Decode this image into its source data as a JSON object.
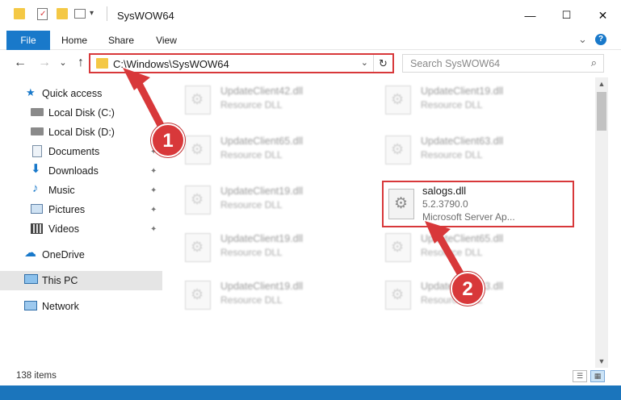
{
  "window": {
    "title": "SysWOW64",
    "minimize_symbol": "—",
    "maximize_symbol": "☐",
    "close_symbol": "✕"
  },
  "ribbon": {
    "tabs": [
      "File",
      "Home",
      "Share",
      "View"
    ],
    "expand_symbol": "⌄",
    "help_symbol": "?"
  },
  "navigation": {
    "back_symbol": "←",
    "forward_symbol": "→",
    "recent_symbol": "⌄",
    "up_symbol": "↑"
  },
  "address": {
    "path": "C:\\Windows\\SysWOW64",
    "dropdown_symbol": "⌄",
    "refresh_symbol": "↻"
  },
  "search": {
    "placeholder": "Search SysWOW64",
    "icon_symbol": "⌕"
  },
  "sidebar": {
    "items": [
      {
        "label": "Quick access",
        "icon": "star-icon"
      },
      {
        "label": "Local Disk (C:)",
        "icon": "drive-icon"
      },
      {
        "label": "Local Disk (D:)",
        "icon": "drive-icon"
      },
      {
        "label": "Documents",
        "icon": "documents-icon"
      },
      {
        "label": "Downloads",
        "icon": "download-icon"
      },
      {
        "label": "Music",
        "icon": "music-icon"
      },
      {
        "label": "Pictures",
        "icon": "pictures-icon"
      },
      {
        "label": "Videos",
        "icon": "videos-icon"
      },
      {
        "label": "OneDrive",
        "icon": "cloud-icon"
      },
      {
        "label": "This PC",
        "icon": "computer-icon"
      },
      {
        "label": "Network",
        "icon": "network-icon"
      }
    ],
    "pin_symbol": "📌"
  },
  "files": [
    {
      "name": "UpdateClient42.dll",
      "type": "Resource DLL"
    },
    {
      "name": "UpdateClient19.dll",
      "type": "Resource DLL"
    },
    {
      "name": "UpdateClient65.dll",
      "type": "Resource DLL"
    },
    {
      "name": "UpdateClient63.dll",
      "type": "Resource DLL"
    },
    {
      "name": "UpdateClient19.dll",
      "type": "Resource DLL"
    },
    {
      "name": "UpdateClient19.dll",
      "type": "Resource DLL"
    },
    {
      "name": "UpdateClient65.dll",
      "type": "Resource DLL"
    },
    {
      "name": "UpdateClient19.dll",
      "type": "Resource DLL"
    },
    {
      "name": "UpdateClient63.dll",
      "type": "Resource DLL"
    }
  ],
  "highlighted_file": {
    "name": "salogs.dll",
    "version": "5.2.3790.0",
    "description": "Microsoft Server Ap..."
  },
  "status": {
    "item_count": "138 items"
  },
  "callouts": [
    {
      "number": "1"
    },
    {
      "number": "2"
    }
  ],
  "colors": {
    "accent": "#1979ca",
    "highlight_border": "#d8383a",
    "folder": "#f4c845"
  }
}
